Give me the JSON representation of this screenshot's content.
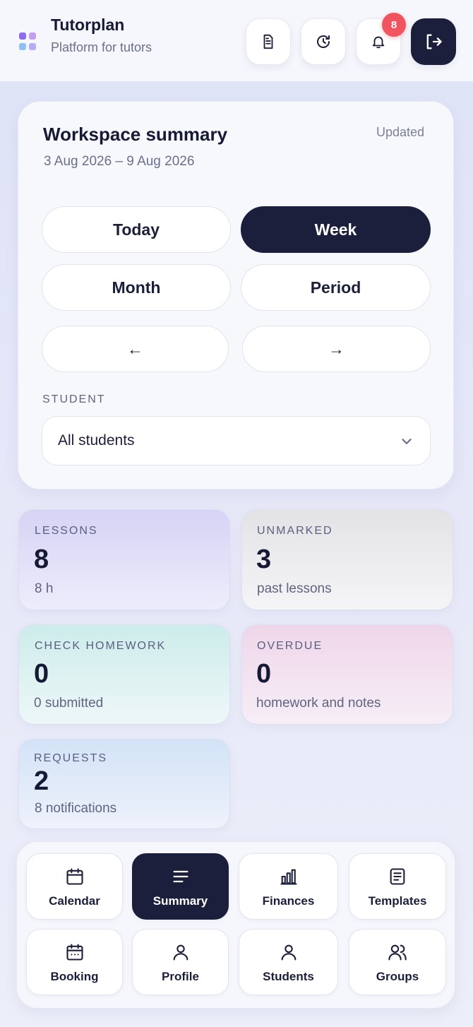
{
  "header": {
    "app_name": "Tutorplan",
    "tagline": "Platform for tutors",
    "actions": [
      {
        "icon": "document-icon"
      },
      {
        "icon": "history-icon"
      },
      {
        "icon": "bell-icon",
        "badge": "8"
      },
      {
        "icon": "logout-icon"
      }
    ]
  },
  "summary": {
    "title": "Workspace summary",
    "range": "3 Aug 2026 – 9 Aug 2026",
    "status": "Updated",
    "periods": [
      "Today",
      "Week",
      "Month",
      "Period"
    ],
    "active_period": "Week",
    "prev_label": "←",
    "next_label": "→",
    "student_label": "STUDENT",
    "student_value": "All students"
  },
  "stats": [
    {
      "label": "LESSONS",
      "value": "8",
      "sub": "8 h"
    },
    {
      "label": "UNMARKED",
      "value": "3",
      "sub": "past lessons"
    },
    {
      "label": "CHECK HOMEWORK",
      "value": "0",
      "sub": "0 submitted"
    },
    {
      "label": "OVERDUE",
      "value": "0",
      "sub": "homework and notes"
    },
    {
      "label": "REQUESTS",
      "value": "2",
      "sub": "8 notifications"
    }
  ],
  "nav": {
    "items": [
      {
        "label": "Calendar",
        "icon": "calendar-icon"
      },
      {
        "label": "Summary",
        "icon": "menu-lines-icon",
        "active": true
      },
      {
        "label": "Finances",
        "icon": "bar-chart-icon"
      },
      {
        "label": "Templates",
        "icon": "template-icon"
      },
      {
        "label": "Booking",
        "icon": "booking-icon"
      },
      {
        "label": "Profile",
        "icon": "user-icon"
      },
      {
        "label": "Students",
        "icon": "user-icon"
      },
      {
        "label": "Groups",
        "icon": "users-icon"
      }
    ]
  },
  "colors": {
    "accent_dark": "#1c1f3c",
    "badge_red": "#f0545f",
    "tile_lessons": "#d6d3f5",
    "tile_unmarked": "#e3e3e6",
    "tile_homework": "#cdeceb",
    "tile_overdue": "#efd6ea",
    "tile_requests": "#d3e3f7"
  }
}
